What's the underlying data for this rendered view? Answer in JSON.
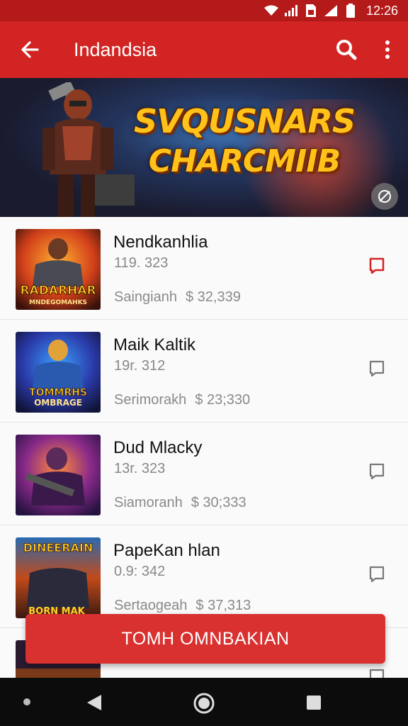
{
  "status_bar": {
    "time": "12:26",
    "icons": [
      "wifi-icon",
      "signal-icon",
      "sim-icon",
      "signal-icon",
      "battery-icon"
    ]
  },
  "app_bar": {
    "title": "Indandsia",
    "back_icon": "arrow-left-icon",
    "search_icon": "search-icon",
    "menu_icon": "more-vert-icon"
  },
  "banner": {
    "title_line1": "SVQUSNARS",
    "title_line2": "CHARCMIIB",
    "share_icon": "share-icon"
  },
  "items": [
    {
      "name": "Nendkanhlia",
      "sub": "119. 323",
      "seller": "Saingianh",
      "price": "$ 32,339",
      "bookmark": "bookmark-filled-icon",
      "thumb_text_top": "RADARHAR",
      "thumb_text_bottom": "MNDEGOMAHKS"
    },
    {
      "name": "Maik Kaltik",
      "sub": "19r. 312",
      "seller": "Serimorakh",
      "price": "$ 23;330",
      "bookmark": "bookmark-outline-icon",
      "thumb_text_top": "TOMMRHS",
      "thumb_text_bottom": "OMBRAGE"
    },
    {
      "name": "Dud Mlacky",
      "sub": "13r. 323",
      "seller": "Siamoranh",
      "price": "$ 30;333",
      "bookmark": "bookmark-outline-icon",
      "thumb_text_top": "",
      "thumb_text_bottom": ""
    },
    {
      "name": "PapeKan hlan",
      "sub": "0.9: 342",
      "seller": "Sertaogeah",
      "price": "$ 37,313",
      "bookmark": "bookmark-outline-icon",
      "thumb_text_top": "DINEERAIN",
      "thumb_text_bottom": "BORN MAK"
    }
  ],
  "cta": {
    "label": "TOMH OMNBAKIAN"
  },
  "colors": {
    "primary": "#d32424",
    "status": "#b51a1a",
    "cta": "#d93030",
    "bookmark_active": "#d32424"
  }
}
